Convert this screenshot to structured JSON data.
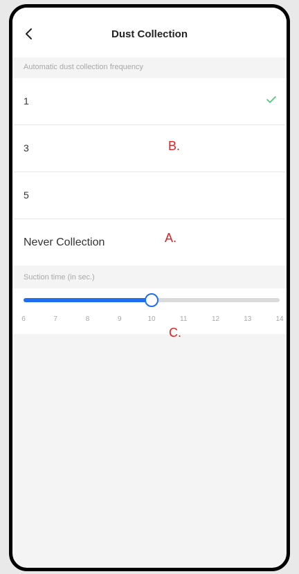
{
  "header": {
    "title": "Dust Collection",
    "back_icon": "chevron-left-icon"
  },
  "frequency": {
    "section_label": "Automatic dust collection frequency",
    "selected_index": 0,
    "check_color": "#4cc771",
    "options": [
      {
        "label": "1"
      },
      {
        "label": "3"
      },
      {
        "label": "5"
      },
      {
        "label": "Never Collection"
      }
    ]
  },
  "suction": {
    "section_label": "Suction time (in sec.)",
    "min": 6,
    "max": 14,
    "value": 10,
    "accent": "#1f6ef2",
    "ticks": [
      "6",
      "7",
      "8",
      "9",
      "10",
      "11",
      "12",
      "13",
      "14"
    ]
  },
  "annotations": {
    "a": "A.",
    "b": "B.",
    "c": "C.",
    "color": "#e02020"
  }
}
